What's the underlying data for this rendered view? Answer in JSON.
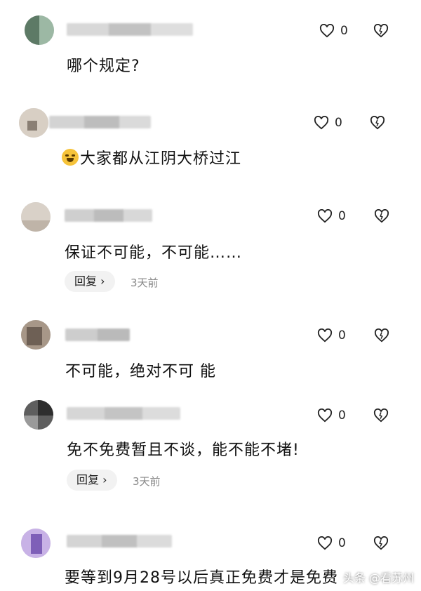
{
  "comments": [
    {
      "text": "哪个规定?",
      "likes": "0",
      "colors": [
        "#6f8a76",
        "#a9c2b0",
        "#3c4a40"
      ]
    },
    {
      "text": "大家都从江阴大桥过江",
      "likes": "0",
      "emoji": "laugh-cry-emoji",
      "colors": [
        "#cfc6bb",
        "#9a8f83",
        "#e6e0d8"
      ]
    },
    {
      "text": "保证不可能，不可能……",
      "likes": "0",
      "reply_label": "回复",
      "time": "3天前",
      "colors": [
        "#d5cdc3",
        "#b9aea2",
        "#eee7df"
      ]
    },
    {
      "text": "不可能，绝对不可 能",
      "likes": "0",
      "colors": [
        "#9a8a7c",
        "#6c5e54",
        "#cbbfb5"
      ]
    },
    {
      "text": "免不免费暂且不谈，能不能不堵!",
      "likes": "0",
      "reply_label": "回复",
      "time": "3天前",
      "colors": [
        "#6a6a6a",
        "#3a3a3a",
        "#9a9a9a"
      ]
    },
    {
      "text": "要等到9月28号以后真正免费才是免费",
      "likes": "0",
      "colors": [
        "#c9b3e6",
        "#8c6fc2",
        "#e9def7"
      ]
    }
  ],
  "watermark": "头条 @看苏州",
  "icons": {
    "like": "heart-icon",
    "dislike": "broken-heart-icon",
    "reply": "chevron-right-icon"
  }
}
